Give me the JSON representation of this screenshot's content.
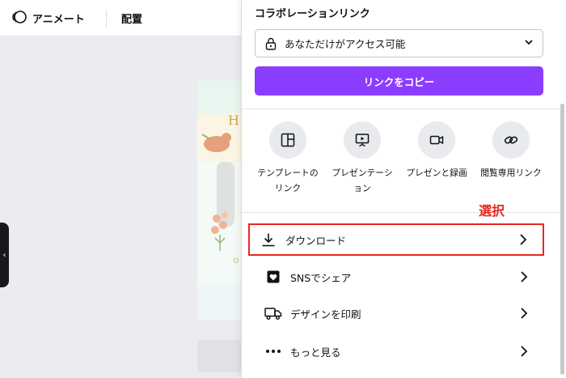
{
  "topbar": {
    "animate_label": "アニメート",
    "position_label": "配置"
  },
  "share_panel": {
    "collab_title": "コラボレーションリンク",
    "access_value": "あなただけがアクセス可能",
    "copy_link_label": "リンクをコピー",
    "options": [
      {
        "icon": "template-layout-icon",
        "label": "テンプレートの\nリンク"
      },
      {
        "icon": "presentation-icon",
        "label": "プレゼンテーシ\nョン"
      },
      {
        "icon": "video-camera-icon",
        "label": "プレゼンと録画"
      },
      {
        "icon": "link-icon",
        "label": "閲覧専用リンク"
      }
    ],
    "rows": {
      "download": "ダウンロード",
      "sns_share": "SNSでシェア",
      "print_design": "デザインを印刷",
      "more": "もっと見る"
    }
  },
  "annotation": {
    "select_label": "選択",
    "color": "#e8281f"
  },
  "colors": {
    "accent": "#8b3dff",
    "panel_bg": "#ffffff",
    "canvas_bg": "#ebecf0"
  }
}
